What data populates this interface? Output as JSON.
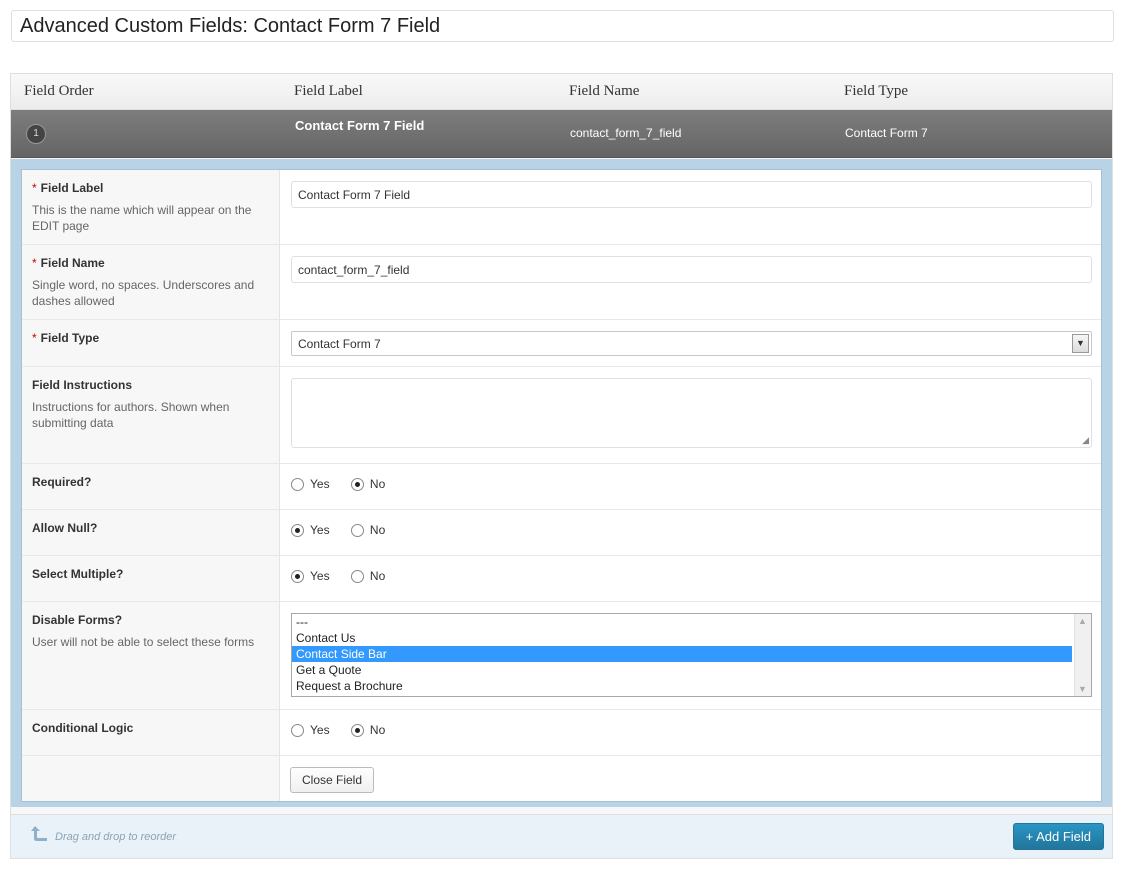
{
  "page_title": "Advanced Custom Fields: Contact Form 7 Field",
  "table_header": {
    "field_order": "Field Order",
    "field_label": "Field Label",
    "field_name": "Field Name",
    "field_type": "Field Type"
  },
  "field_row": {
    "order": "1",
    "label": "Contact Form 7 Field",
    "name": "contact_form_7_field",
    "type": "Contact Form 7"
  },
  "form": {
    "field_label": {
      "label": "Field Label",
      "required_mark": "*",
      "description": "This is the name which will appear on the EDIT page",
      "value": "Contact Form 7 Field"
    },
    "field_name": {
      "label": "Field Name",
      "required_mark": "*",
      "description": "Single word, no spaces. Underscores and dashes allowed",
      "value": "contact_form_7_field"
    },
    "field_type": {
      "label": "Field Type",
      "required_mark": "*",
      "value": "Contact Form 7"
    },
    "field_instructions": {
      "label": "Field Instructions",
      "description": "Instructions for authors. Shown when submitting data",
      "value": ""
    },
    "required": {
      "label": "Required?",
      "yes": "Yes",
      "no": "No",
      "selected": "No"
    },
    "allow_null": {
      "label": "Allow Null?",
      "yes": "Yes",
      "no": "No",
      "selected": "Yes"
    },
    "select_multiple": {
      "label": "Select Multiple?",
      "yes": "Yes",
      "no": "No",
      "selected": "Yes"
    },
    "disable_forms": {
      "label": "Disable Forms?",
      "description": "User will not be able to select these forms",
      "options": [
        "---",
        "Contact Us",
        "Contact Side Bar",
        "Get a Quote",
        "Request a Brochure"
      ],
      "selected": "Contact Side Bar"
    },
    "conditional_logic": {
      "label": "Conditional Logic",
      "yes": "Yes",
      "no": "No",
      "selected": "No"
    },
    "close_button": "Close Field"
  },
  "footer": {
    "drag_hint": "Drag and drop to reorder",
    "add_button": "+ Add Field"
  },
  "colors": {
    "accent": "#21759b",
    "selection": "#3399ff",
    "header_dark": "#6e6e6e",
    "editor_border": "#b8d2e6"
  }
}
